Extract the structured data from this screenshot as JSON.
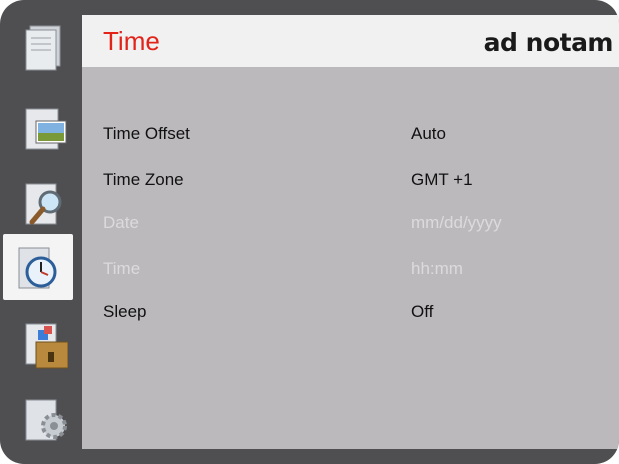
{
  "header": {
    "title": "Time",
    "brand": "ad notam"
  },
  "settings": [
    {
      "label": "Time Offset",
      "value": "Auto",
      "enabled": true
    },
    {
      "label": "Time Zone",
      "value": "GMT +1",
      "enabled": true
    },
    {
      "label": "Date",
      "value": "mm/dd/yyyy",
      "enabled": false
    },
    {
      "label": "Time",
      "value": "hh:mm",
      "enabled": false
    },
    {
      "label": "Sleep",
      "value": "Off",
      "enabled": true
    }
  ],
  "sidebar": {
    "items": [
      {
        "icon": "documents-icon",
        "active": false
      },
      {
        "icon": "picture-icon",
        "active": false
      },
      {
        "icon": "magnifier-icon",
        "active": false
      },
      {
        "icon": "clock-icon",
        "active": true
      },
      {
        "icon": "package-icon",
        "active": false
      },
      {
        "icon": "gear-icon",
        "active": false
      }
    ]
  },
  "colors": {
    "title": "#e2231a",
    "panel": "#bcb9bd",
    "frame": "#4f4f51",
    "disabled_text": "#dddadd"
  }
}
